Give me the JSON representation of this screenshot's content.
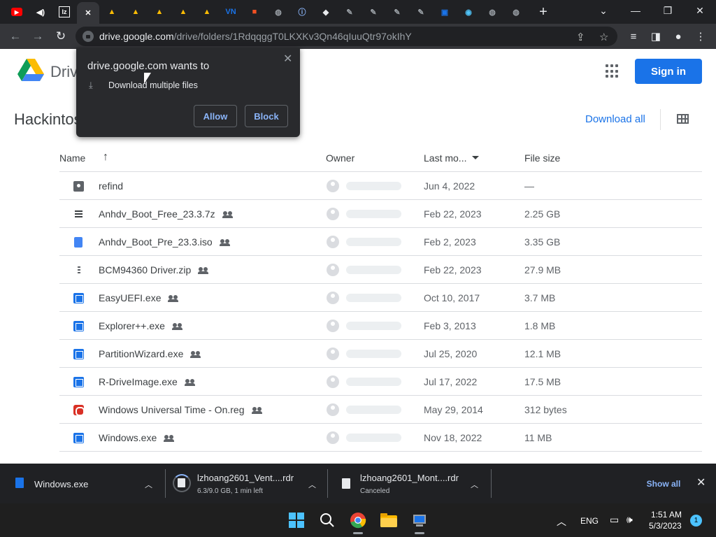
{
  "browser": {
    "tabs": [
      {
        "icon": "youtube-icon",
        "color": "#ff0000"
      },
      {
        "icon": "speaker-icon",
        "color": "#ffffff"
      },
      {
        "icon": "lz-icon",
        "color": "#ffffff"
      },
      {
        "icon": "close-icon",
        "color": "#ffffff",
        "active": true
      },
      {
        "icon": "google-drive-icon",
        "color": "#fbbc04"
      },
      {
        "icon": "google-drive-icon",
        "color": "#fbbc04"
      },
      {
        "icon": "google-drive-icon",
        "color": "#fbbc04"
      },
      {
        "icon": "google-drive-icon",
        "color": "#fbbc04"
      },
      {
        "icon": "google-drive-icon",
        "color": "#fbbc04"
      },
      {
        "icon": "vn-icon",
        "color": "#1a73e8"
      },
      {
        "icon": "microsoft-icon",
        "color": "#f25022"
      },
      {
        "icon": "globe-icon",
        "color": "#9aa0a6"
      },
      {
        "icon": "info-icon",
        "color": "#8ab4f8"
      },
      {
        "icon": "diamond-icon",
        "color": "#e8eaed"
      },
      {
        "icon": "tool-icon",
        "color": "#9aa0a6"
      },
      {
        "icon": "tool-icon",
        "color": "#9aa0a6"
      },
      {
        "icon": "tool-icon",
        "color": "#9aa0a6"
      },
      {
        "icon": "tool-icon",
        "color": "#9aa0a6"
      },
      {
        "icon": "image-icon",
        "color": "#1a73e8"
      },
      {
        "icon": "eye-icon",
        "color": "#4fc3f7"
      },
      {
        "icon": "globe-icon",
        "color": "#9aa0a6"
      },
      {
        "icon": "globe-icon",
        "color": "#9aa0a6"
      }
    ],
    "new_tab": "+",
    "url_host": "drive.google.com",
    "url_path": "/drive/folders/1RdqqggT0LKXKv3Qn46qIuuQtr97okIhY"
  },
  "drive": {
    "product_name": "Drive",
    "sign_in_label": "Sign in",
    "folder_title": "Hackintosh",
    "download_all_label": "Download all",
    "columns": {
      "name": "Name",
      "owner": "Owner",
      "last_modified": "Last mo...",
      "file_size": "File size"
    },
    "files": [
      {
        "name": "refind",
        "type": "folder",
        "shared": false,
        "modified": "Jun 4, 2022",
        "size": "—"
      },
      {
        "name": "Anhdv_Boot_Free_23.3.7z",
        "type": "list",
        "shared": true,
        "modified": "Feb 22, 2023",
        "size": "2.25 GB"
      },
      {
        "name": "Anhdv_Boot_Pre_23.3.iso",
        "type": "doc",
        "shared": true,
        "modified": "Feb 2, 2023",
        "size": "3.35 GB"
      },
      {
        "name": "BCM94360 Driver.zip",
        "type": "zip",
        "shared": true,
        "modified": "Feb 22, 2023",
        "size": "27.9 MB"
      },
      {
        "name": "EasyUEFI.exe",
        "type": "exe",
        "shared": true,
        "modified": "Oct 10, 2017",
        "size": "3.7 MB"
      },
      {
        "name": "Explorer++.exe",
        "type": "exe",
        "shared": true,
        "modified": "Feb 3, 2013",
        "size": "1.8 MB"
      },
      {
        "name": "PartitionWizard.exe",
        "type": "exe",
        "shared": true,
        "modified": "Jul 25, 2020",
        "size": "12.1 MB"
      },
      {
        "name": "R-DriveImage.exe",
        "type": "exe",
        "shared": true,
        "modified": "Jul 17, 2022",
        "size": "17.5 MB"
      },
      {
        "name": "Windows Universal Time - On.reg",
        "type": "reg",
        "shared": true,
        "modified": "May 29, 2014",
        "size": "312 bytes"
      },
      {
        "name": "Windows.exe",
        "type": "exe",
        "shared": true,
        "modified": "Nov 18, 2022",
        "size": "11 MB"
      }
    ]
  },
  "permission_popup": {
    "title": "drive.google.com wants to",
    "item": "Download multiple files",
    "allow_label": "Allow",
    "block_label": "Block"
  },
  "download_shelf": {
    "items": [
      {
        "name": "Windows.exe",
        "status": ""
      },
      {
        "name": "lzhoang2601_Vent....rdr",
        "status": "6.3/9.0 GB, 1 min left",
        "progress": 0.7
      },
      {
        "name": "lzhoang2601_Mont....rdr",
        "status": "Canceled"
      }
    ],
    "show_all_label": "Show all"
  },
  "taskbar": {
    "language": "ENG",
    "time": "1:51 AM",
    "date": "5/3/2023",
    "notification_count": "1"
  }
}
